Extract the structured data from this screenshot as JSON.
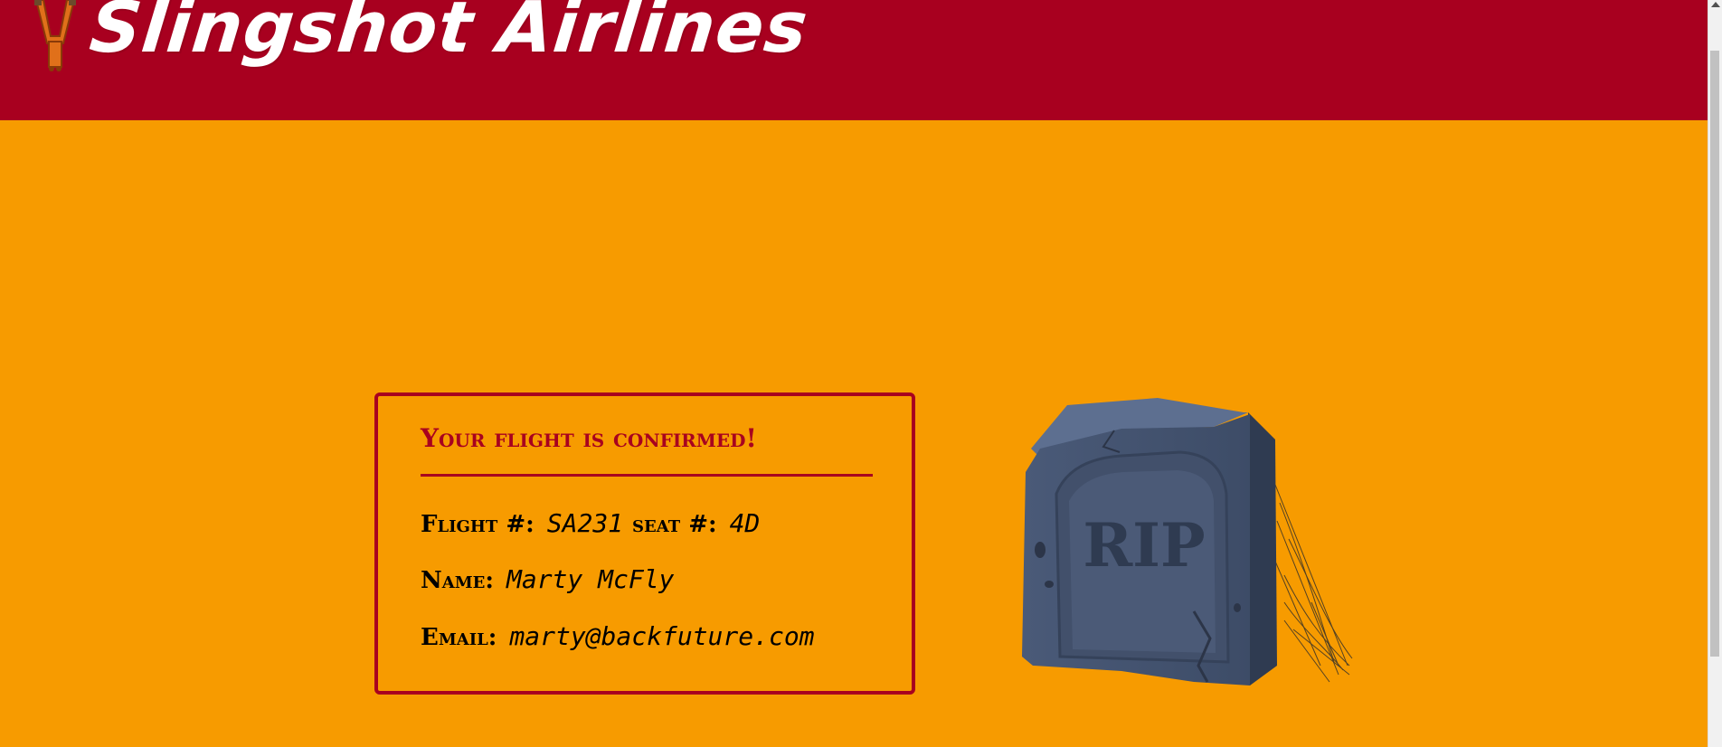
{
  "header": {
    "brand": "Slingshot Airlines"
  },
  "confirmation": {
    "title": "Your flight is confirmed!",
    "flight_label": "Flight #:",
    "flight_value": "SA231",
    "seat_label": "seat #:",
    "seat_value": "4D",
    "name_label": "Name:",
    "name_value": "Marty McFly",
    "email_label": "Email:",
    "email_value": "marty@backfuture.com"
  },
  "illustration": {
    "tombstone_text": "RIP",
    "icon": "tombstone-icon"
  },
  "colors": {
    "header": "#a8001f",
    "background": "#f79b00",
    "accent": "#a8001f",
    "slingshot": "#e0701a"
  }
}
